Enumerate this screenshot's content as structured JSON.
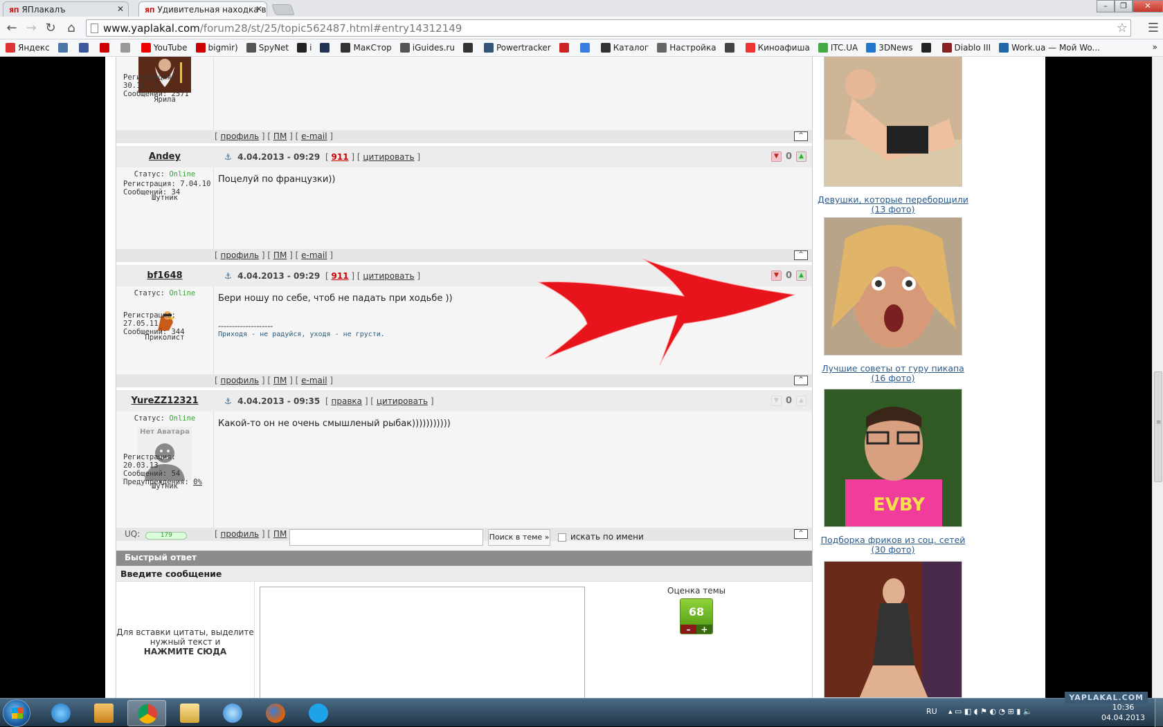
{
  "tabs": [
    {
      "label": "ЯПлакалъ",
      "favicon": "ЯП",
      "active": false
    },
    {
      "label": "Удивительная находка в с",
      "favicon": "ЯП",
      "active": true
    }
  ],
  "toolbar": {
    "url_host": "www.yaplakal.com",
    "url_path": "/forum28/st/25/topic562487.html#entry14312149"
  },
  "bookmarks": [
    {
      "label": "Яндекс",
      "icon": "yandex-icon",
      "color": "#d33"
    },
    {
      "label": "",
      "icon": "vk-icon",
      "color": "#4a76a8"
    },
    {
      "label": "",
      "icon": "facebook-icon",
      "color": "#3b5998"
    },
    {
      "label": "",
      "icon": "yap-icon",
      "color": "#c00"
    },
    {
      "label": "",
      "icon": "ex-icon",
      "color": "#999"
    },
    {
      "label": "YouTube",
      "icon": "youtube-icon",
      "color": "#e00"
    },
    {
      "label": "bigmir)",
      "icon": "bigmir-icon",
      "color": "#c00"
    },
    {
      "label": "SpyNet",
      "icon": "spynet-icon",
      "color": "#555"
    },
    {
      "label": "i",
      "icon": "i-icon",
      "color": "#222"
    },
    {
      "label": "",
      "icon": "flag-icon",
      "color": "#235"
    },
    {
      "label": "МакСтор",
      "icon": "apple-icon",
      "color": "#333"
    },
    {
      "label": "iGuides.ru",
      "icon": "iguides-icon",
      "color": "#555"
    },
    {
      "label": "",
      "icon": "apple2-icon",
      "color": "#333"
    },
    {
      "label": "Powertracker",
      "icon": "powertracker-icon",
      "color": "#357"
    },
    {
      "label": "",
      "icon": "red-circle-icon",
      "color": "#c22"
    },
    {
      "label": "",
      "icon": "google-icon",
      "color": "#3a7be0"
    },
    {
      "label": "Каталог",
      "icon": "catalog-icon",
      "color": "#333"
    },
    {
      "label": "Настройка",
      "icon": "g-icon",
      "color": "#666"
    },
    {
      "label": "",
      "icon": "shield-icon",
      "color": "#444"
    },
    {
      "label": "Киноафиша",
      "icon": "kinoafisha-icon",
      "color": "#e33"
    },
    {
      "label": "ITC.UA",
      "icon": "itc-icon",
      "color": "#4a4"
    },
    {
      "label": "3DNews",
      "icon": "3dnews-icon",
      "color": "#27c"
    },
    {
      "label": "",
      "icon": "b-icon",
      "color": "#222"
    },
    {
      "label": "Diablo III",
      "icon": "diablo-icon",
      "color": "#822"
    },
    {
      "label": "Work.ua — Мой Wo...",
      "icon": "workua-icon",
      "color": "#26a"
    }
  ],
  "bookmarks_more": "»",
  "labels": {
    "profile": "профиль",
    "pm": "ПМ",
    "email": "e-mail",
    "quote": "цитировать",
    "edit": "правка",
    "status": "Статус:",
    "online": "Online",
    "reg": "Регистрация:",
    "msgs": "Сообщений:",
    "warns": "Предупреждения:",
    "up": "[^]"
  },
  "post0": {
    "nick": "Ярила",
    "reg": "30.11.10",
    "msgs": "2571"
  },
  "post1": {
    "author": "Andey",
    "date": "4.04.2013 - 09:29",
    "report": "911",
    "votes": "0",
    "rank": "Шутник",
    "reg": "7.04.10",
    "msgs": "34",
    "text": "Поцелуй по французки))"
  },
  "post2": {
    "author": "bf1648",
    "date": "4.04.2013 - 09:29",
    "report": "911",
    "votes": "0",
    "rank": "Приколист",
    "reg": "27.05.11",
    "msgs": "344",
    "text": "Бери ношу по себе, чтоб не падать при ходьбе ))",
    "sig_sep": "--------------------",
    "signature": "Приходя - не радуйся, уходя - не грусти."
  },
  "post3": {
    "author": "YureZZ12321",
    "date": "4.04.2013 - 09:35",
    "votes": "0",
    "rank": "Шутник",
    "no_avatar": "Нет Аватара",
    "reg": "20.03.13",
    "msgs": "54",
    "warns": "0%",
    "text": "Какой-то он не очень смышленый рыбак)))))))))))",
    "uq_label": "UQ:",
    "uq_value": "179"
  },
  "search": {
    "button": "Поиск в теме »",
    "checkbox_label": "искать по имени"
  },
  "quick_reply": {
    "title": "Быстрый ответ",
    "subtitle": "Введите сообщение",
    "hint_line1": "Для вставки цитаты, выделите",
    "hint_line2": "нужный текст и",
    "hint_line3": "НАЖМИТЕ СЮДА",
    "rating_label": "Оценка темы",
    "rating_value": "68",
    "minus": "–",
    "plus": "+"
  },
  "promos": [
    {
      "caption1": "Девушки, которые переборщили",
      "caption2": "(13 фото)"
    },
    {
      "caption1": "Лучшие советы от гуру пикапа",
      "caption2": "(16 фото)"
    },
    {
      "caption1": "Подборка фриков из соц. сетей",
      "caption2": "(30 фото)"
    },
    {
      "caption1": "",
      "caption2": ""
    }
  ],
  "taskbar": {
    "lang": "RU",
    "time": "10:36",
    "date": "04.04.2013",
    "watermark": "YAPLAKAL.COM"
  },
  "colors": {
    "arrow": "#e8141c",
    "online": "#33aa33",
    "report": "#cc0000",
    "rating": "#6fb524"
  }
}
